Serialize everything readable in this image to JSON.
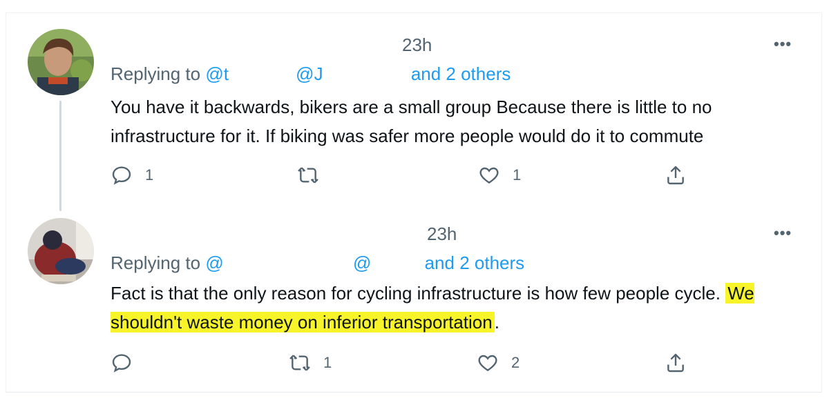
{
  "tweets": [
    {
      "name": "",
      "handle": "",
      "time": "23h",
      "more_label": "•••",
      "replying_prefix": "Replying to",
      "mention1": "@t",
      "mention2": "@J",
      "replying_suffix": "and 2 others",
      "text": "You have it backwards, bikers are a small group Because there is little to no infrastructure for it. If biking was safer more people would do it to commute",
      "highlight": "",
      "actions": {
        "reply_count": "1",
        "retweet_count": "",
        "like_count": "1"
      },
      "icons": [
        "reply-icon",
        "retweet-icon",
        "like-icon",
        "share-icon"
      ]
    },
    {
      "name": "",
      "handle": "",
      "time": "23h",
      "more_label": "•••",
      "replying_prefix": "Replying to",
      "mention1": "@",
      "mention2": "@",
      "replying_suffix": "and 2 others",
      "text": "Fact is that the only reason for cycling infrastructure is how few people cycle. ",
      "highlight": "We shouldn't waste money on inferior transportation",
      "text_end": ".",
      "actions": {
        "reply_count": "",
        "retweet_count": "1",
        "like_count": "2"
      },
      "icons": [
        "reply-icon",
        "retweet-icon",
        "like-icon",
        "share-icon"
      ]
    }
  ],
  "colors": {
    "link": "#1d9bf0",
    "muted": "#536471",
    "text": "#0f1419",
    "highlight": "#f7f52a"
  }
}
